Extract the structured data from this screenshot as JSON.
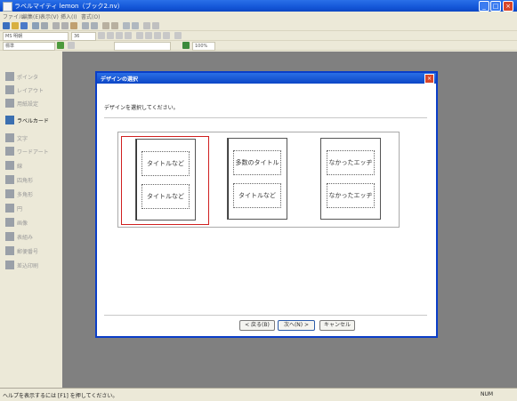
{
  "window": {
    "title": "ラベルマイティ lemon（ブック2.nv）"
  },
  "menu": [
    "ファイル",
    "編集(E)",
    "表示(V)",
    "挿入(I)",
    "書式(O)"
  ],
  "toolbar": {
    "font_size": "36",
    "font_name": "MS 明朝",
    "style_select": "標準",
    "zoom": "100%"
  },
  "left_panel": {
    "items": [
      {
        "label": "ポインタ",
        "active": false
      },
      {
        "label": "レイアウト",
        "active": false
      },
      {
        "label": "用紙設定",
        "active": false
      },
      {
        "label": "ラベルカード",
        "active": true
      },
      {
        "label": "文字",
        "active": false
      },
      {
        "label": "ワードアート",
        "active": false
      },
      {
        "label": "線",
        "active": false
      },
      {
        "label": "四角形",
        "active": false
      },
      {
        "label": "多角形",
        "active": false
      },
      {
        "label": "円",
        "active": false
      },
      {
        "label": "画像",
        "active": false
      },
      {
        "label": "表組み",
        "active": false
      },
      {
        "label": "郵便番号",
        "active": false
      },
      {
        "label": "差込印刷",
        "active": false
      }
    ]
  },
  "dialog": {
    "title": "デザインの選択",
    "instruction": "デザインを選択してください。",
    "options": [
      {
        "top_label": "タイトルなど",
        "bottom_label": "タイトルなど",
        "selected": true
      },
      {
        "top_label": "多数のタイトル",
        "bottom_label": "タイトルなど",
        "selected": false
      },
      {
        "top_label": "なかったエッヂ",
        "bottom_label": "なかったエッヂ",
        "selected": false
      }
    ],
    "buttons": {
      "back": "< 戻る(B)",
      "next": "次へ(N) >",
      "cancel": "キャンセル"
    }
  },
  "statusbar": {
    "text": "ヘルプを表示するには [F1] を押してください。",
    "num": "NUM"
  },
  "colors": {
    "titlebar": "#1457d8",
    "selection": "#d02020",
    "workspace": "#808080"
  }
}
